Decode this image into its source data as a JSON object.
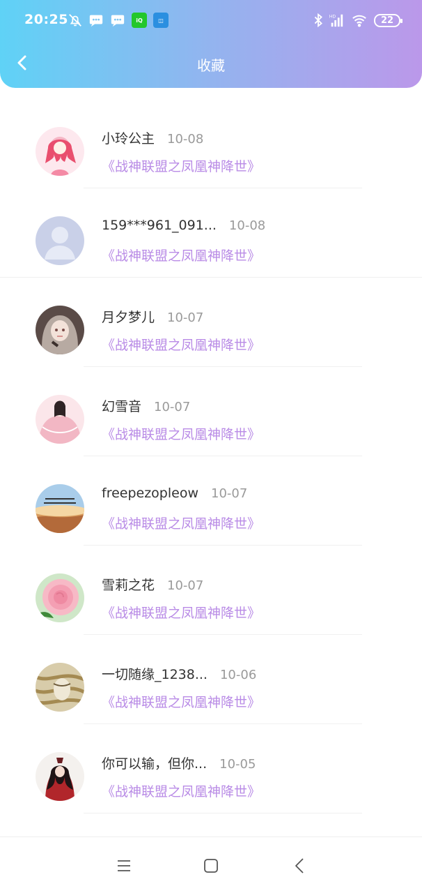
{
  "status_bar": {
    "time": "20:25",
    "battery": "22",
    "signal_label": "HD",
    "icons": [
      "silent-alarm-icon",
      "message-icon",
      "message-icon",
      "iqiyi-icon",
      "app-icon",
      "bluetooth-icon",
      "signal-icon",
      "wifi-icon",
      "battery-icon"
    ]
  },
  "header": {
    "title": "收藏",
    "back_icon": "chevron-left-icon"
  },
  "colors": {
    "header_start": "#5fd2f6",
    "header_end": "#bb98ea",
    "title_accent": "#b98be6",
    "date_gray": "#9a9a9a"
  },
  "favorites": [
    {
      "name": "小玲公主",
      "date": "10-08",
      "title": "《战神联盟之凤凰神降世》",
      "avatar": "anime-girl-pink"
    },
    {
      "name": "159***961_091...",
      "date": "10-08",
      "title": "《战神联盟之凤凰神降世》",
      "avatar": "default-user"
    },
    {
      "name": "月夕梦儿",
      "date": "10-07",
      "title": "《战神联盟之凤凰神降世》",
      "avatar": "anime-girl-gray"
    },
    {
      "name": "幻雪音",
      "date": "10-07",
      "title": "《战神联盟之凤凰神降世》",
      "avatar": "anime-girl-hanfu"
    },
    {
      "name": "freepezopleow",
      "date": "10-07",
      "title": "《战神联盟之凤凰神降世》",
      "avatar": "sunset-landscape"
    },
    {
      "name": "雪莉之花",
      "date": "10-07",
      "title": "《战神联盟之凤凰神降世》",
      "avatar": "pink-rose"
    },
    {
      "name": "一切随缘_1238...",
      "date": "10-06",
      "title": "《战神联盟之凤凰神降世》",
      "avatar": "gold-texture"
    },
    {
      "name": "你可以输，但你...",
      "date": "10-05",
      "title": "《战神联盟之凤凰神降世》",
      "avatar": "red-robed-character"
    }
  ],
  "bottom_nav": {
    "items": [
      "menu-icon",
      "home-square-icon",
      "back-triangle-icon"
    ]
  }
}
